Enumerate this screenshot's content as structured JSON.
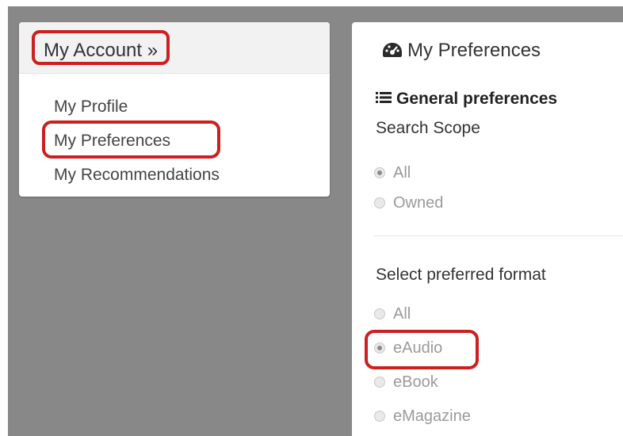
{
  "account_panel": {
    "title": "My Account »",
    "links": [
      "My Profile",
      "My Preferences",
      "My Recommendations"
    ]
  },
  "preferences_panel": {
    "title": "My Preferences",
    "title_icon": "dashboard-icon",
    "section_heading": "General preferences",
    "section_icon": "list-icon",
    "search_scope": {
      "label": "Search Scope",
      "options": [
        "All",
        "Owned"
      ],
      "selected": "All"
    },
    "preferred_format": {
      "label": "Select preferred format",
      "options": [
        "All",
        "eAudio",
        "eBook",
        "eMagazine"
      ],
      "selected": "eAudio"
    }
  },
  "colors": {
    "highlight": "#cc1f1f",
    "background": "#888888",
    "panel": "#ffffff"
  }
}
